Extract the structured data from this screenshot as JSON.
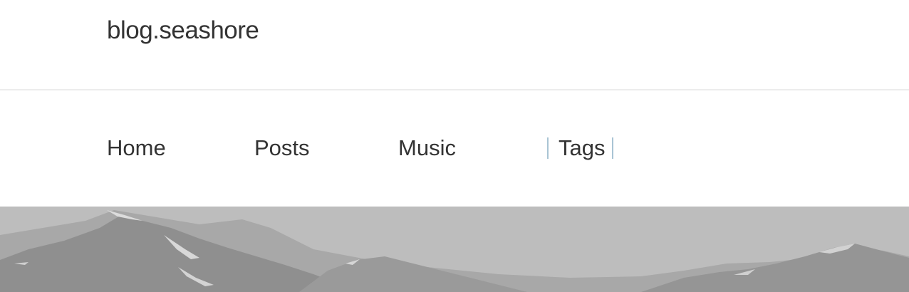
{
  "site": {
    "title": "blog.seashore"
  },
  "nav": {
    "items": [
      {
        "label": "Home"
      },
      {
        "label": "Posts"
      },
      {
        "label": "Music"
      },
      {
        "label": "Tags",
        "active": true
      }
    ],
    "active_accent": "#a9c4d4"
  },
  "hero": {
    "image_subject": "grayscale mountain range",
    "background": "#b9b9b9"
  }
}
